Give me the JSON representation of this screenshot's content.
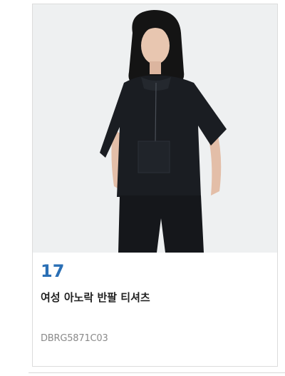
{
  "product": {
    "rank": "17",
    "name": "여성 아노락 반팔 티셔츠",
    "code": "DBRG5871C03",
    "image_alt": "model wearing black anorak short-sleeve shirt"
  },
  "colors": {
    "rank": "#2a6fb5",
    "name": "#222222",
    "code": "#8a8a8a",
    "border": "#dcdcdc",
    "photo_bg": "#eef0f1"
  }
}
